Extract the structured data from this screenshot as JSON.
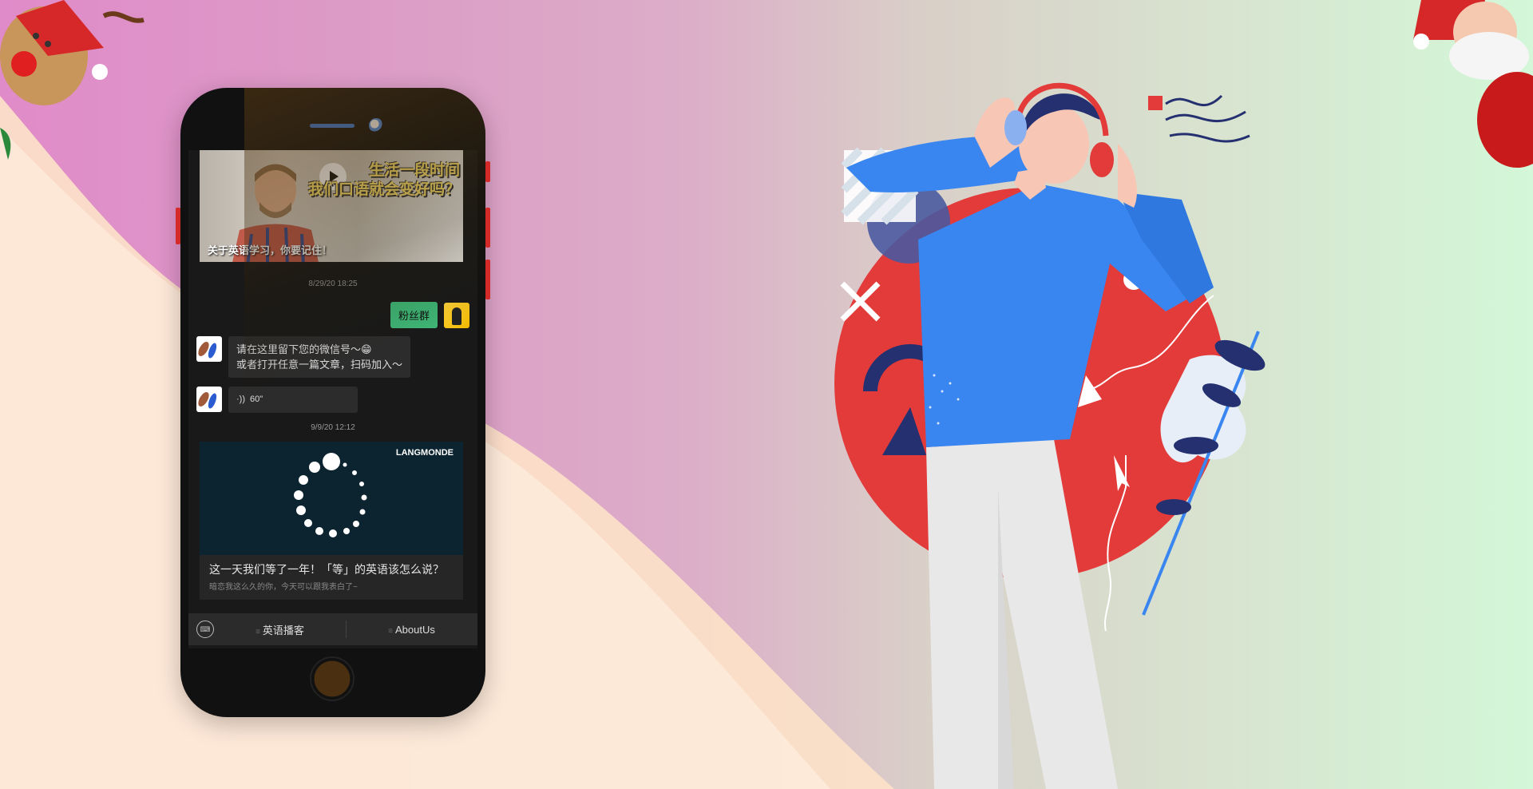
{
  "video": {
    "title_line1": "生活一段时间",
    "title_line2": "我们口语就会变好吗？",
    "caption": "关于英语学习，你要记住！"
  },
  "chat": {
    "timestamp1": "8/29/20 18:25",
    "self_message": "粉丝群",
    "other_message_line1": "请在这里留下您的微信号～😁",
    "other_message_line2": "或者打开任意一篇文章，扫码加入～",
    "voice_duration": "60\"",
    "timestamp2": "9/9/20 12:12"
  },
  "article": {
    "brand": "LANGMONDE",
    "title": "这一天我们等了一年！「等」的英语该怎么说？",
    "subtitle": "暗恋我这么久的你，今天可以跟我表白了~"
  },
  "menu": {
    "item1": "英语播客",
    "item2": "AboutUs"
  },
  "colors": {
    "bubble_green": "#3eb575",
    "accent_red": "#e03a3a",
    "accent_blue": "#3a86f0"
  }
}
